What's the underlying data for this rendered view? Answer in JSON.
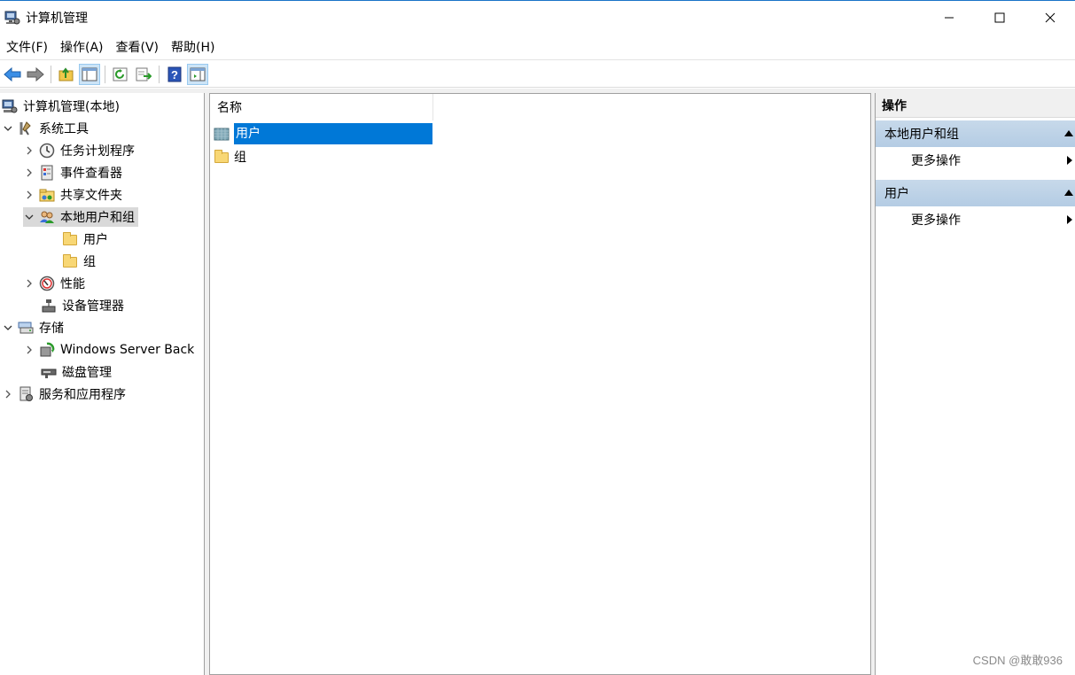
{
  "window": {
    "title": "计算机管理"
  },
  "menu": [
    "文件(F)",
    "操作(A)",
    "查看(V)",
    "帮助(H)"
  ],
  "toolbar": {
    "icons": [
      "back-arrow-icon",
      "forward-arrow-icon",
      "up-folder-icon",
      "show-hide-tree-icon",
      "refresh-icon",
      "export-list-icon",
      "help-icon",
      "show-hide-action-pane-icon"
    ]
  },
  "tree": {
    "root": "计算机管理(本地)",
    "system_tools": "系统工具",
    "task_scheduler": "任务计划程序",
    "event_viewer": "事件查看器",
    "shared_folders": "共享文件夹",
    "local_users_groups": "本地用户和组",
    "users": "用户",
    "groups": "组",
    "performance": "性能",
    "device_manager": "设备管理器",
    "storage": "存储",
    "windows_server_backup": "Windows Server Back",
    "disk_management": "磁盘管理",
    "services_apps": "服务和应用程序"
  },
  "list": {
    "column_name": "名称",
    "rows": [
      {
        "label": "用户",
        "selected": true,
        "icon": "users-folder-icon"
      },
      {
        "label": "组",
        "selected": false,
        "icon": "folder-icon"
      }
    ]
  },
  "actions": {
    "title": "操作",
    "section1": "本地用户和组",
    "section1_more": "更多操作",
    "section2": "用户",
    "section2_more": "更多操作"
  },
  "watermark": "CSDN @敢敢936",
  "colors": {
    "selection": "#0078d7",
    "action_header": "#c7d9ea",
    "tree_selected": "#d9d9d9"
  }
}
